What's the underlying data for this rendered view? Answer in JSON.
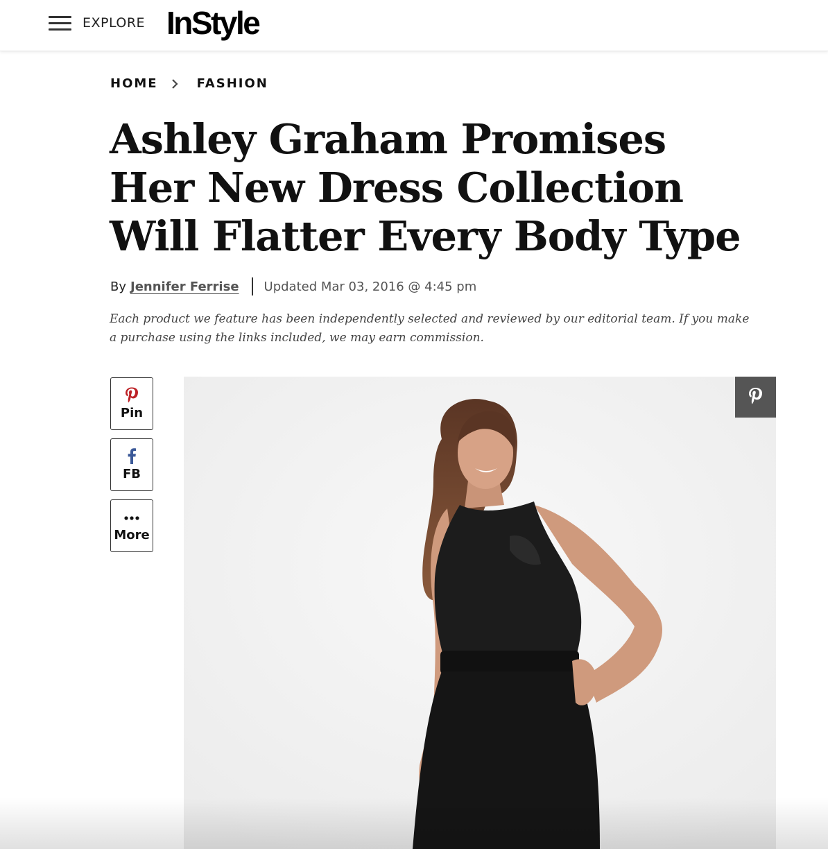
{
  "header": {
    "explore_label": "EXPLORE",
    "logo_text": "InStyle"
  },
  "breadcrumb": {
    "items": [
      "HOME",
      "FASHION"
    ]
  },
  "article": {
    "title": "Ashley Graham Promises Her New Dress Collection Will Flatter Every Body Type",
    "byline_prefix": "By",
    "author": "Jennifer Ferrise",
    "updated": "Updated Mar 03, 2016 @ 4:45 pm",
    "disclaimer": "Each product we feature has been independently selected and reviewed by our editorial team. If you make a purchase using the links included, we may earn commission."
  },
  "share": {
    "pin_label": "Pin",
    "fb_label": "FB",
    "more_label": "More"
  },
  "colors": {
    "pinterest_red": "#bd2126",
    "facebook_blue": "#3b5998",
    "overlay_gray": "#555555"
  },
  "icons": [
    "menu-icon",
    "chevron-right-icon",
    "pinterest-icon",
    "facebook-icon",
    "more-dots-icon"
  ]
}
